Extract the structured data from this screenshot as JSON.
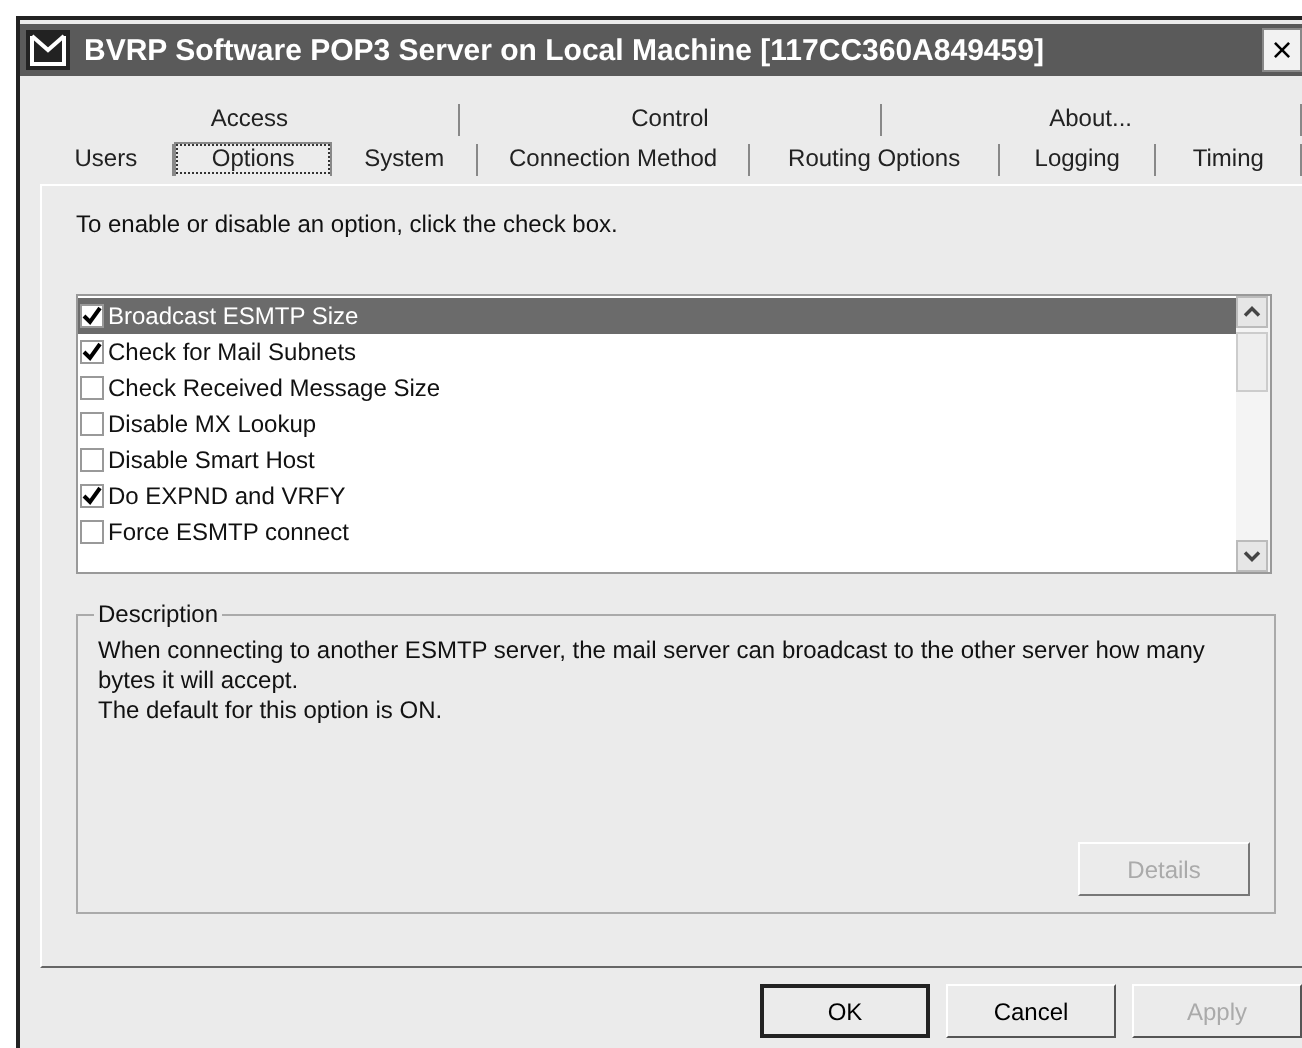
{
  "window": {
    "title": "BVRP Software POP3 Server on Local Machine [117CC360A849459]",
    "close": "×"
  },
  "tab_rows": [
    [
      {
        "label": "Access",
        "selected": false
      },
      {
        "label": "Control",
        "selected": false
      },
      {
        "label": "About...",
        "selected": false
      }
    ],
    [
      {
        "label": "Users",
        "selected": false
      },
      {
        "label": "Options",
        "selected": true
      },
      {
        "label": "System",
        "selected": false
      },
      {
        "label": "Connection Method",
        "selected": false
      },
      {
        "label": "Routing Options",
        "selected": false
      },
      {
        "label": "Logging",
        "selected": false
      },
      {
        "label": "Timing",
        "selected": false
      }
    ]
  ],
  "instruction": "To enable or disable an option, click the check box.",
  "options": [
    {
      "label": "Broadcast ESMTP Size",
      "checked": true,
      "selected": true
    },
    {
      "label": "Check for Mail Subnets",
      "checked": true,
      "selected": false
    },
    {
      "label": "Check Received Message Size",
      "checked": false,
      "selected": false
    },
    {
      "label": "Disable MX Lookup",
      "checked": false,
      "selected": false
    },
    {
      "label": "Disable Smart Host",
      "checked": false,
      "selected": false
    },
    {
      "label": "Do EXPND and VRFY",
      "checked": true,
      "selected": false
    },
    {
      "label": "Force ESMTP connect",
      "checked": false,
      "selected": false
    }
  ],
  "description": {
    "title": "Description",
    "lines": [
      "When connecting to another ESMTP server, the mail server can broadcast to the other server how many bytes it will accept.",
      "The default for this option is ON."
    ],
    "button": {
      "label": "Details",
      "disabled": true
    }
  },
  "buttons": [
    {
      "label": "OK",
      "disabled": false,
      "default": true
    },
    {
      "label": "Cancel",
      "disabled": false,
      "default": false
    },
    {
      "label": "Apply",
      "disabled": true,
      "default": false
    }
  ]
}
